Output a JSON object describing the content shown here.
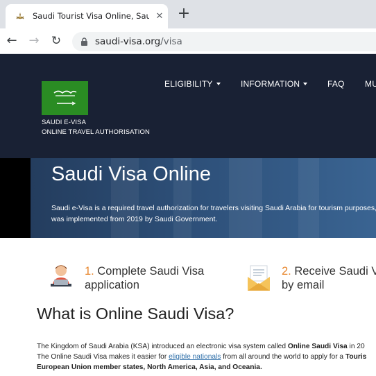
{
  "browser": {
    "tab_title": "Saudi Tourist Visa Online, Saudi V",
    "url_host": "saudi-visa.org",
    "url_path": "/visa"
  },
  "header": {
    "brand_line1": "SAUDI E-VISA",
    "brand_line2": "ONLINE TRAVEL AUTHORISATION",
    "nav": [
      {
        "label": "ELIGIBILITY"
      },
      {
        "label": "INFORMATION"
      },
      {
        "label": "FAQ"
      },
      {
        "label": "MU"
      }
    ]
  },
  "hero": {
    "title": "Saudi Visa Online",
    "text_line1": "Saudi e-Visa is a required travel authorization for travelers visiting Saudi Arabia for tourism purposes,",
    "text_line2": "was implemented from 2019 by Saudi Government."
  },
  "steps": [
    {
      "num": "1.",
      "line1": "Complete Saudi Visa",
      "line2": "application"
    },
    {
      "num": "2.",
      "line1": "Receive Saudi V",
      "line2": "by email"
    }
  ],
  "section": {
    "title": "What is Online Saudi Visa?",
    "p1_a": "The Kingdom of Saudi Arabia (KSA) introduced an electronic visa system called ",
    "p1_b": "Online Saudi Visa",
    "p1_c": " in 20",
    "p2_a": "The Online Saudi Visa makes it easier for ",
    "p2_link": "eligible nationals",
    "p2_b": " from all around the world to apply for a ",
    "p2_c": "Touris",
    "p3": "European Union member states, North America, Asia, and Oceania."
  },
  "colors": {
    "header_bg": "#192134",
    "flag_green": "#2a8c23",
    "accent_orange": "#e8872e",
    "link_blue": "#2d6ea8"
  }
}
